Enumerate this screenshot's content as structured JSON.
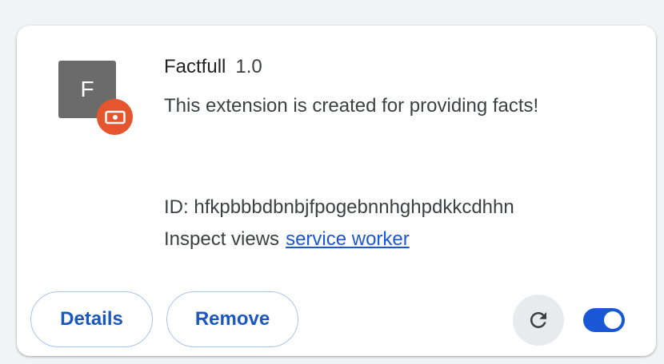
{
  "extension": {
    "icon_letter": "F",
    "name": "Factfull",
    "version": "1.0",
    "description": "This extension is created for providing facts!",
    "id_label": "ID:",
    "id_value": "hfkpbbbdbnbjfpogebnnhghpdkkcdhhn",
    "inspect_label": "Inspect views",
    "inspect_link": "service worker",
    "enabled": true
  },
  "buttons": {
    "details": "Details",
    "remove": "Remove"
  },
  "icons": {
    "badge": "unpacked-extension-badge-icon",
    "reload": "reload-icon"
  },
  "colors": {
    "accent": "#1a57d6",
    "badge": "#e5562f",
    "icon_bg": "#6b6b6b"
  }
}
